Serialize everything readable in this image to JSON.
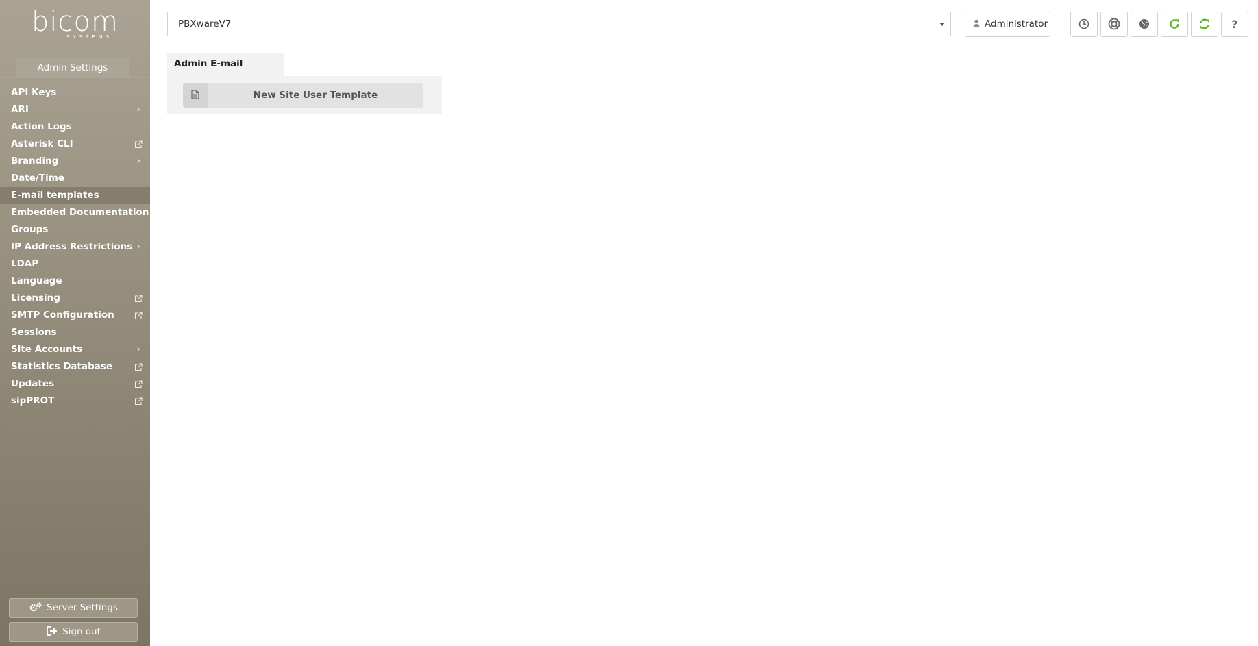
{
  "brand": {
    "logo_text": "bicom",
    "logo_subtext": "SYSTEMS"
  },
  "sidebar": {
    "section_tab": "Admin Settings",
    "items": [
      {
        "label": "API Keys",
        "suffix": "none"
      },
      {
        "label": "ARI",
        "suffix": "chevron"
      },
      {
        "label": "Action Logs",
        "suffix": "none"
      },
      {
        "label": "Asterisk CLI",
        "suffix": "external"
      },
      {
        "label": "Branding",
        "suffix": "chevron"
      },
      {
        "label": "Date/Time",
        "suffix": "none"
      },
      {
        "label": "E-mail templates",
        "suffix": "none",
        "active": true
      },
      {
        "label": "Embedded Documentation",
        "suffix": "none"
      },
      {
        "label": "Groups",
        "suffix": "none"
      },
      {
        "label": "IP Address Restrictions",
        "suffix": "chevron"
      },
      {
        "label": "LDAP",
        "suffix": "none"
      },
      {
        "label": "Language",
        "suffix": "none"
      },
      {
        "label": "Licensing",
        "suffix": "external"
      },
      {
        "label": "SMTP Configuration",
        "suffix": "external"
      },
      {
        "label": "Sessions",
        "suffix": "none"
      },
      {
        "label": "Site Accounts",
        "suffix": "chevron"
      },
      {
        "label": "Statistics Database",
        "suffix": "external"
      },
      {
        "label": "Updates",
        "suffix": "external"
      },
      {
        "label": "sipPROT",
        "suffix": "external"
      }
    ],
    "server_settings_label": "Server Settings",
    "sign_out_label": "Sign out"
  },
  "header": {
    "site_select_value": "PBXwareV7",
    "user_label": "Administrator",
    "tools": [
      {
        "name": "clock-icon",
        "color": "#666666"
      },
      {
        "name": "lifebuoy-icon",
        "color": "#666666"
      },
      {
        "name": "globe-icon",
        "color": "#666666"
      },
      {
        "name": "reload-icon",
        "color": "#5cb82e"
      },
      {
        "name": "sync-icon",
        "color": "#5cb82e"
      },
      {
        "name": "help-icon",
        "color": "#666666"
      }
    ]
  },
  "main": {
    "tab_title": "Admin E-mail Templates",
    "template_button_label": "New Site User Template"
  }
}
